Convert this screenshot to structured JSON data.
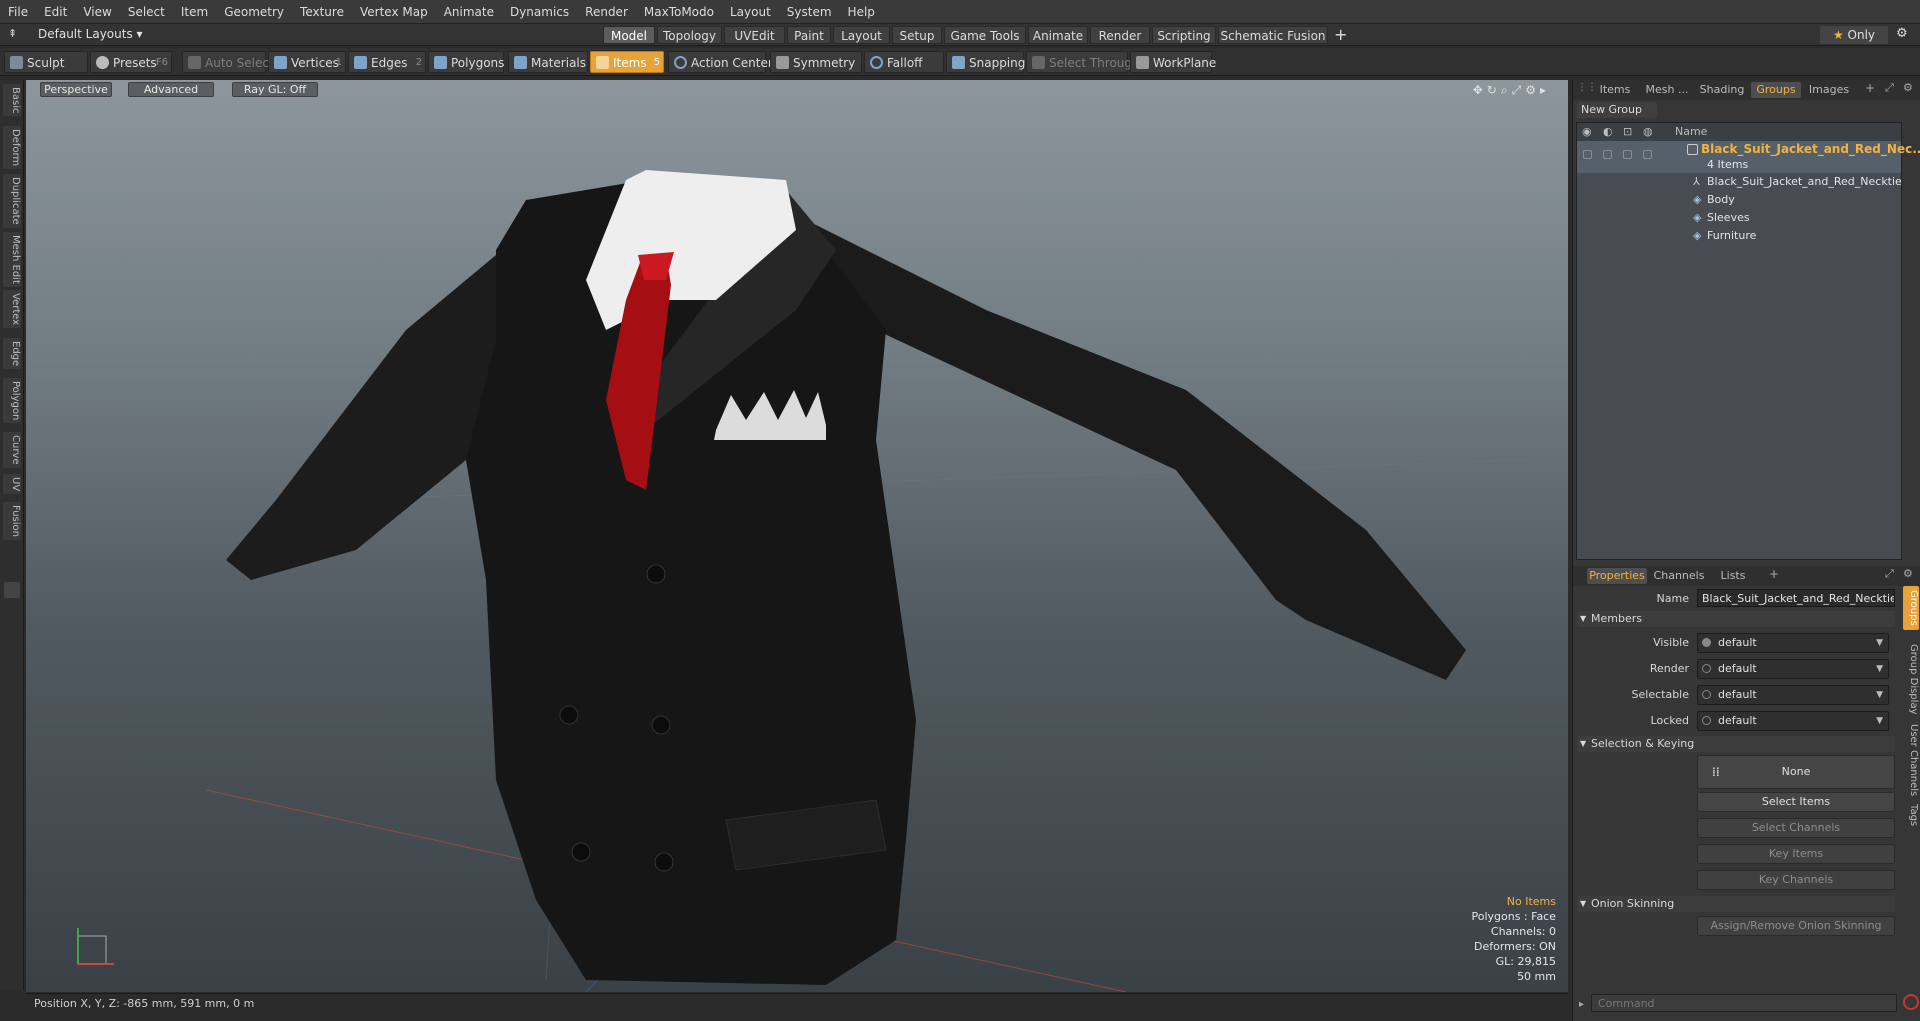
{
  "menu": [
    "File",
    "Edit",
    "View",
    "Select",
    "Item",
    "Geometry",
    "Texture",
    "Vertex Map",
    "Animate",
    "Dynamics",
    "Render",
    "MaxToModo",
    "Layout",
    "System",
    "Help"
  ],
  "layout_bar": {
    "default_layouts": "Default Layouts",
    "tabs": [
      "Model",
      "Topology",
      "UVEdit",
      "Paint",
      "Layout",
      "Setup",
      "Game Tools",
      "Animate",
      "Render",
      "Scripting",
      "Schematic Fusion"
    ],
    "active_tab": "Model",
    "add": "+",
    "only": "Only"
  },
  "toolbar": {
    "sculpt": "Sculpt",
    "presets": "Presets",
    "presets_key": "F6",
    "auto_select": "Auto Select",
    "vertices": "Vertices",
    "vertices_num": "1",
    "edges": "Edges",
    "edges_num": "2",
    "polygons": "Polygons",
    "materials": "Materials",
    "items": "Items",
    "items_num": "5",
    "action_center": "Action Center",
    "symmetry": "Symmetry",
    "falloff": "Falloff",
    "snapping": "Snapping",
    "select_through": "Select Through",
    "workplane": "WorkPlane"
  },
  "left_tabs": [
    "Basic",
    "Deform",
    "Duplicate",
    "Mesh Edit",
    "Vertex",
    "Edge",
    "Polygon",
    "Curve",
    "UV",
    "Fusion"
  ],
  "viewport": {
    "view": "Perspective",
    "shading": "Advanced",
    "raygl": "Ray GL: Off",
    "stats": {
      "selection": "No Items",
      "polygons": "Polygons : Face",
      "channels": "Channels: 0",
      "deformers": "Deformers: ON",
      "gl": "GL: 29,815",
      "scale": "50 mm"
    }
  },
  "status": "Position X, Y, Z:  -865 mm, 591 mm, 0 m",
  "right_top_tabs": [
    "Items",
    "Mesh ...",
    "Shading",
    "Groups",
    "Images"
  ],
  "right_top_active": "Groups",
  "new_group": "New Group",
  "tree": {
    "name_header": "Name",
    "group_name": "Black_Suit_Jacket_and_Red_Nec...",
    "group_count": "4 Items",
    "children": [
      "Black_Suit_Jacket_and_Red_Necktie",
      "Body",
      "Sleeves",
      "Furniture"
    ]
  },
  "props_tabs": [
    "Properties",
    "Channels",
    "Lists"
  ],
  "props_active": "Properties",
  "props": {
    "name_label": "Name",
    "name_value": "Black_Suit_Jacket_and_Red_Necktie (",
    "members": "Members",
    "visible_label": "Visible",
    "render_label": "Render",
    "selectable_label": "Selectable",
    "locked_label": "Locked",
    "default_value": "default",
    "selection_keying": "Selection & Keying",
    "none": "None",
    "select_items": "Select Items",
    "select_channels": "Select Channels",
    "key_items": "Key Items",
    "key_channels": "Key Channels",
    "onion_skinning": "Onion Skinning",
    "assign_onion": "Assign/Remove Onion Skinning"
  },
  "side_tabs": [
    "Groups",
    "Group Display",
    "User Channels",
    "Tags"
  ],
  "command_placeholder": "Command",
  "colors": {
    "accent": "#e8a23a",
    "highlight_text": "#f3b23f"
  }
}
